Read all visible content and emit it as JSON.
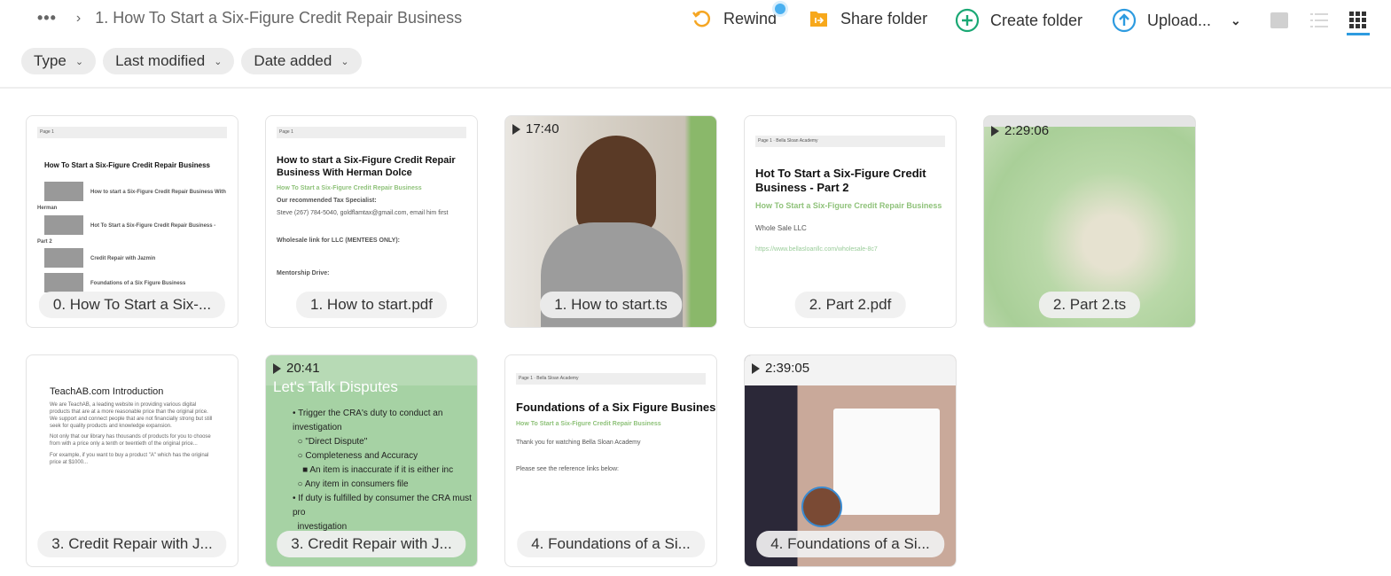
{
  "breadcrumb": {
    "more": "•••",
    "current": "1. How To Start a Six-Figure Credit Repair Business"
  },
  "toolbar": {
    "rewind": "Rewind",
    "share": "Share folder",
    "create": "Create folder",
    "upload": "Upload..."
  },
  "colors": {
    "rewind": "#f5a623",
    "share": "#f5a623",
    "create": "#1aa874",
    "upload": "#2d9be0",
    "active_view": "#2d9be0"
  },
  "filters": [
    {
      "label": "Type"
    },
    {
      "label": "Last modified"
    },
    {
      "label": "Date added"
    }
  ],
  "files": [
    {
      "name": "0. How To Start a Six-...",
      "kind": "doc",
      "heading": "How To Start a Six-Figure Credit Repair Business",
      "rows": [
        "How to start a Six-Figure Credit Repair Business With Herman",
        "Hot To Start a Six-Figure Credit Repair Business - Part 2",
        "Credit Repair with Jazmin",
        "Foundations of a Six Figure Business"
      ]
    },
    {
      "name": "1. How to start.pdf",
      "kind": "pdf",
      "heading": "How to start a Six-Figure Credit Repair Business With Herman Dolce",
      "sub": "How To Start a Six-Figure Credit Repair Business",
      "lines": [
        "Our recommended Tax Specialist:",
        "Steve (267) 784-5040, goldflamtax@gmail.com, email him first",
        "Wholesale link for LLC (MENTEES ONLY):",
        "Mentorship Drive:"
      ]
    },
    {
      "name": "1. How to start.ts",
      "kind": "video",
      "duration": "17:40"
    },
    {
      "name": "2. Part 2.pdf",
      "kind": "pdf",
      "heading": "Hot To Start a Six-Figure Credit Business - Part 2",
      "sub": "How To Start a Six-Figure Credit Repair Business",
      "lines": [
        "Whole Sale LLC",
        "https://www.bellasloanllc.com/wholesale-8c7"
      ]
    },
    {
      "name": "2. Part 2.ts",
      "kind": "video",
      "duration": "2:29:06"
    },
    {
      "name": "3. Credit Repair with J...",
      "kind": "doc2",
      "heading": "TeachAB.com Introduction"
    },
    {
      "name": "3. Credit Repair with J...",
      "kind": "video",
      "duration": "20:41",
      "heading": "Let's Talk Disputes"
    },
    {
      "name": "4. Foundations of a Si...",
      "kind": "pdf",
      "heading": "Foundations of a Six Figure Business",
      "sub": "How To Start a Six-Figure Credit Repair Business",
      "lines": [
        "Thank you for watching Bella Sloan Academy",
        "Please see the reference links below:"
      ]
    },
    {
      "name": "4. Foundations of a Si...",
      "kind": "video",
      "duration": "2:39:05"
    }
  ]
}
